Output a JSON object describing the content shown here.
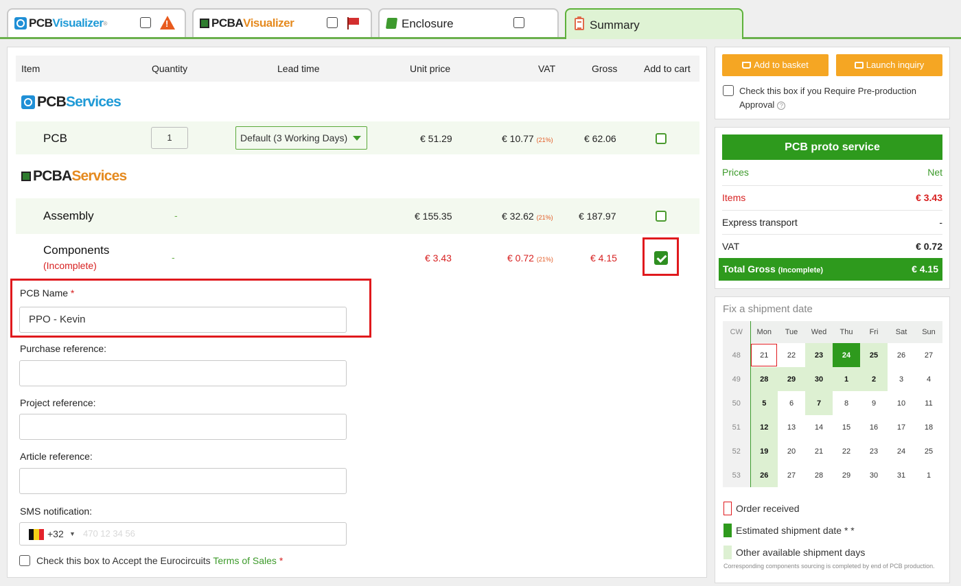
{
  "tabs": [
    {
      "logo_part1": "PCB",
      "logo_part2": "Visualizer",
      "logo_mark": "®"
    },
    {
      "logo_part1": "PCBA",
      "logo_part2": "Visualizer"
    },
    {
      "label": "Enclosure"
    },
    {
      "label": "Summary"
    }
  ],
  "table": {
    "headers": {
      "item": "Item",
      "quantity": "Quantity",
      "lead_time": "Lead time",
      "unit_price": "Unit price",
      "vat": "VAT",
      "gross": "Gross",
      "add_to_cart": "Add to cart"
    },
    "pcb_services_logo": {
      "part1": "PCB",
      "part2": "Services"
    },
    "pcba_services_logo": {
      "part1": "PCBA",
      "part2": "Services"
    },
    "rows": [
      {
        "item": "PCB",
        "quantity": "1",
        "lead_time": "Default (3 Working Days)",
        "unit_price": "€ 51.29",
        "vat": "€ 10.77",
        "vat_pct": "(21%)",
        "gross": "€ 62.06",
        "checked": false
      },
      {
        "item": "Assembly",
        "quantity": "-",
        "unit_price": "€ 155.35",
        "vat": "€ 32.62",
        "vat_pct": "(21%)",
        "gross": "€ 187.97",
        "checked": false
      },
      {
        "item": "Components",
        "note": "(Incomplete)",
        "quantity": "-",
        "unit_price": "€ 3.43",
        "vat": "€ 0.72",
        "vat_pct": "(21%)",
        "gross": "€ 4.15",
        "checked": true
      }
    ]
  },
  "form": {
    "pcb_name": {
      "label": "PCB Name",
      "required": "*",
      "value": "PPO - Kevin"
    },
    "purchase_reference": {
      "label": "Purchase reference:",
      "value": ""
    },
    "project_reference": {
      "label": "Project reference:",
      "value": ""
    },
    "article_reference": {
      "label": "Article reference:",
      "value": ""
    },
    "sms_notification": {
      "label": "SMS notification:",
      "country_code": "+32",
      "caret": "▼",
      "placeholder": "470 12 34 56"
    },
    "accept_terms": {
      "text": "Check this box to Accept the Eurocircuits",
      "link": "Terms of Sales",
      "required": "*"
    }
  },
  "actions": {
    "add_to_basket": "Add to basket",
    "launch_inquiry": "Launch inquiry",
    "preproduction": "Check this box if you Require Pre-production Approval",
    "help": "?"
  },
  "summary": {
    "service_title": "PCB proto service",
    "prices_label": "Prices",
    "net_label": "Net",
    "items_label": "Items",
    "items_value": "€ 3.43",
    "express_label": "Express transport",
    "express_value": "-",
    "vat_label": "VAT",
    "vat_value": "€ 0.72",
    "total_label": "Total Gross",
    "total_note": "(Incomplete)",
    "total_value": "€ 4.15"
  },
  "calendar": {
    "title": "Fix a shipment date",
    "headers": [
      "CW",
      "Mon",
      "Tue",
      "Wed",
      "Thu",
      "Fri",
      "Sat",
      "Sun"
    ],
    "weeks": [
      {
        "cw": "48",
        "days": [
          "21",
          "22",
          "23",
          "24",
          "25",
          "26",
          "27"
        ],
        "status": [
          "recv",
          "norm",
          "avail",
          "est",
          "avail",
          "norm",
          "norm"
        ]
      },
      {
        "cw": "49",
        "days": [
          "28",
          "29",
          "30",
          "1",
          "2",
          "3",
          "4"
        ],
        "status": [
          "avail",
          "avail",
          "avail",
          "avail",
          "avail",
          "norm",
          "norm"
        ]
      },
      {
        "cw": "50",
        "days": [
          "5",
          "6",
          "7",
          "8",
          "9",
          "10",
          "11"
        ],
        "status": [
          "avail",
          "norm",
          "avail",
          "norm",
          "norm",
          "norm",
          "norm"
        ]
      },
      {
        "cw": "51",
        "days": [
          "12",
          "13",
          "14",
          "15",
          "16",
          "17",
          "18"
        ],
        "status": [
          "avail",
          "norm",
          "norm",
          "norm",
          "norm",
          "norm",
          "norm"
        ]
      },
      {
        "cw": "52",
        "days": [
          "19",
          "20",
          "21",
          "22",
          "23",
          "24",
          "25"
        ],
        "status": [
          "avail",
          "norm",
          "norm",
          "norm",
          "norm",
          "norm",
          "norm"
        ]
      },
      {
        "cw": "53",
        "days": [
          "26",
          "27",
          "28",
          "29",
          "30",
          "31",
          "1"
        ],
        "status": [
          "avail",
          "norm",
          "norm",
          "norm",
          "norm",
          "norm",
          "norm"
        ]
      }
    ],
    "legend": {
      "order_received": "Order received",
      "estimated": "Estimated shipment date * *",
      "other": "Other available shipment days"
    },
    "footnote": "Corresponding components sourcing is completed by end of PCB production."
  },
  "colors": {
    "accent_green": "#2e9a1d",
    "orange": "#f5a623",
    "red": "#e0191d"
  }
}
